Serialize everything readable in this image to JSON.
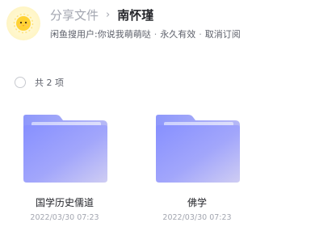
{
  "header": {
    "parent_label": "分享文件",
    "separator": "›",
    "current_title": "南怀瑾",
    "sharer": "闲鱼搜用户:你说我萌萌哒",
    "validity": "永久有效",
    "cancel_label": "取消订阅",
    "dot": "·"
  },
  "selection": {
    "count_label": "共 2 项"
  },
  "files": [
    {
      "name": "国学历史儒道",
      "date": "2022/03/30 07:23",
      "icon": "folder-icon"
    },
    {
      "name": "佛学",
      "date": "2022/03/30 07:23",
      "icon": "folder-icon"
    }
  ],
  "colors": {
    "folder_back": "#8f9cf9",
    "folder_front_start": "#8a93ff",
    "folder_front_end": "#c3c2f5",
    "avatar_sun": "#ffd233"
  }
}
